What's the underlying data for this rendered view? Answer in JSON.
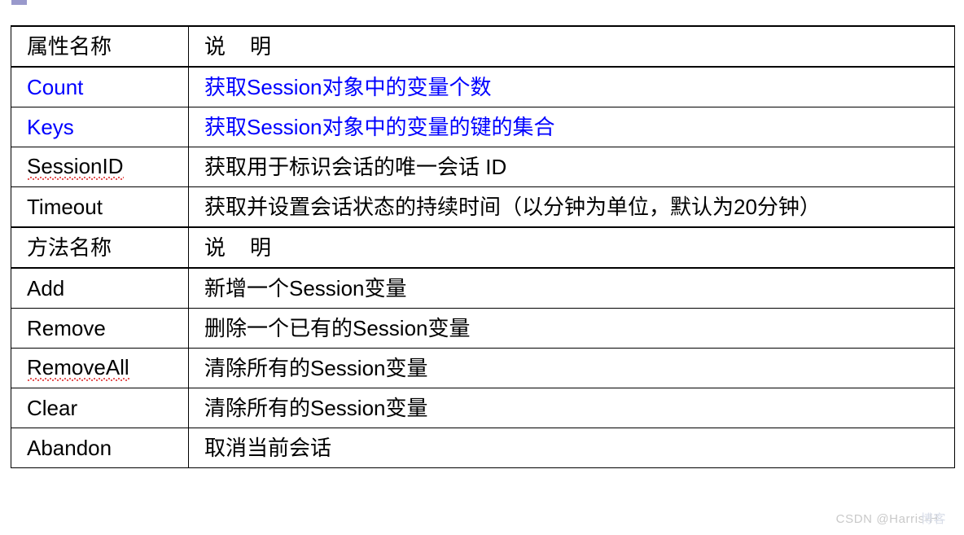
{
  "decorations": {
    "top_marker_color": "#9999cc"
  },
  "colors": {
    "highlight_text": "#0000ff",
    "default_text": "#000000",
    "border": "#000000",
    "watermark": "#c9c9c9"
  },
  "table": {
    "columns": [
      "属性名称",
      "说　明"
    ],
    "sections": [
      {
        "header": {
          "name": "属性名称",
          "desc_prefix": "说",
          "desc_suffix": "明"
        },
        "rows": [
          {
            "name": "Count",
            "desc": "获取Session对象中的变量个数",
            "highlight": true,
            "misspelled": false
          },
          {
            "name": "Keys",
            "desc": "获取Session对象中的变量的键的集合",
            "highlight": true,
            "misspelled": false
          },
          {
            "name": "SessionID",
            "desc": "获取用于标识会话的唯一会话 ID",
            "highlight": false,
            "misspelled": true
          },
          {
            "name": "Timeout",
            "desc": "获取并设置会话状态的持续时间（以分钟为单位，默认为20分钟）",
            "highlight": false,
            "misspelled": false
          }
        ]
      },
      {
        "header": {
          "name": "方法名称",
          "desc_prefix": "说",
          "desc_suffix": "明"
        },
        "rows": [
          {
            "name": "Add",
            "desc": "新增一个Session变量",
            "highlight": false,
            "misspelled": false
          },
          {
            "name": "Remove",
            "desc": "删除一个已有的Session变量",
            "highlight": false,
            "misspelled": false
          },
          {
            "name": "RemoveAll",
            "desc": "清除所有的Session变量",
            "highlight": false,
            "misspelled": true
          },
          {
            "name": "Clear",
            "desc": "清除所有的Session变量",
            "highlight": false,
            "misspelled": false
          },
          {
            "name": "Abandon",
            "desc": "取消当前会话",
            "highlight": false,
            "misspelled": false
          }
        ]
      }
    ]
  },
  "watermark": {
    "text": "CSDN @Harris-H",
    "overlay": "博客"
  }
}
